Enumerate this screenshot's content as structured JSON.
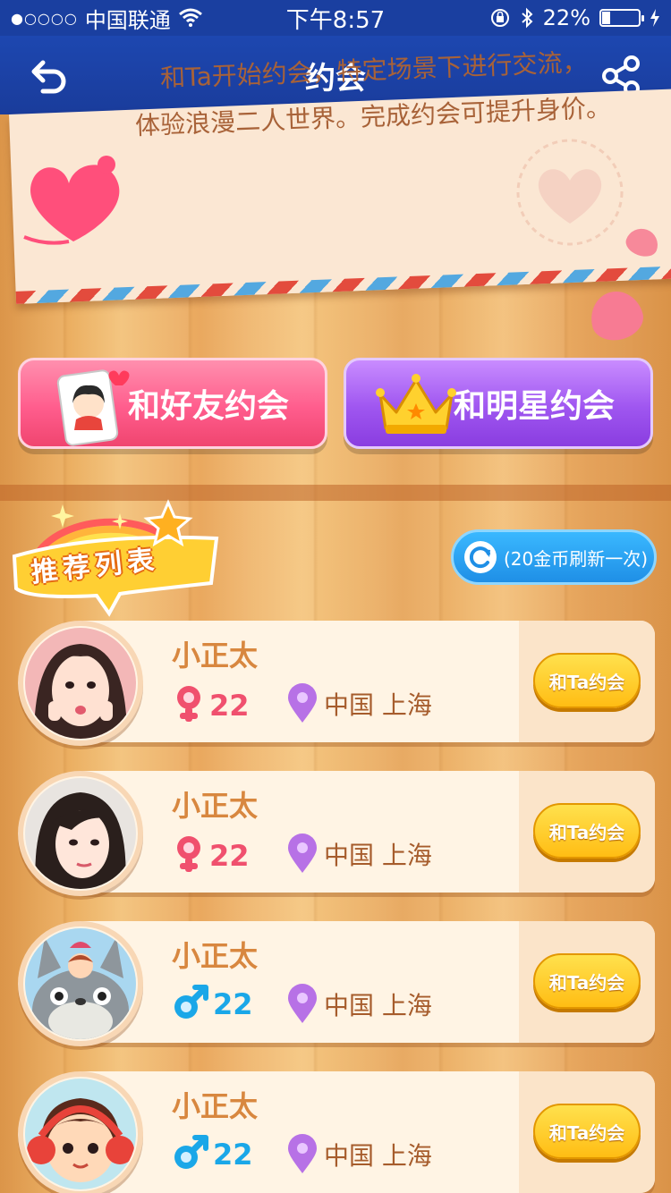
{
  "status_bar": {
    "signal_dots": "●○○○○",
    "carrier": "中国联通",
    "time": "下午8:57",
    "battery_percent": "22%",
    "battery_level": 0.22
  },
  "nav": {
    "title": "约会",
    "back_icon": "back-arrow-icon",
    "share_icon": "share-icon"
  },
  "banner": {
    "line1": "和Ta开始约会，特定场景下进行交流，",
    "line2": "体验浪漫二人世界。完成约会可提升身价。"
  },
  "actions": {
    "friend_date": "和好友约会",
    "star_date": "和明星约会"
  },
  "recommend": {
    "badge_label": "推荐列表",
    "refresh_label": "(20金币刷新一次)"
  },
  "list": [
    {
      "name": "小正太",
      "gender": "female",
      "age": "22",
      "location": "中国 上海",
      "button": "和Ta约会"
    },
    {
      "name": "小正太",
      "gender": "female",
      "age": "22",
      "location": "中国 上海",
      "button": "和Ta约会"
    },
    {
      "name": "小正太",
      "gender": "male",
      "age": "22",
      "location": "中国 上海",
      "button": "和Ta约会"
    },
    {
      "name": "小正太",
      "gender": "male",
      "age": "22",
      "location": "中国 上海",
      "button": "和Ta约会"
    }
  ],
  "colors": {
    "nav_bg": "#1d47b0",
    "female": "#f0506e",
    "male": "#1aa7e8",
    "name": "#d8873f"
  }
}
